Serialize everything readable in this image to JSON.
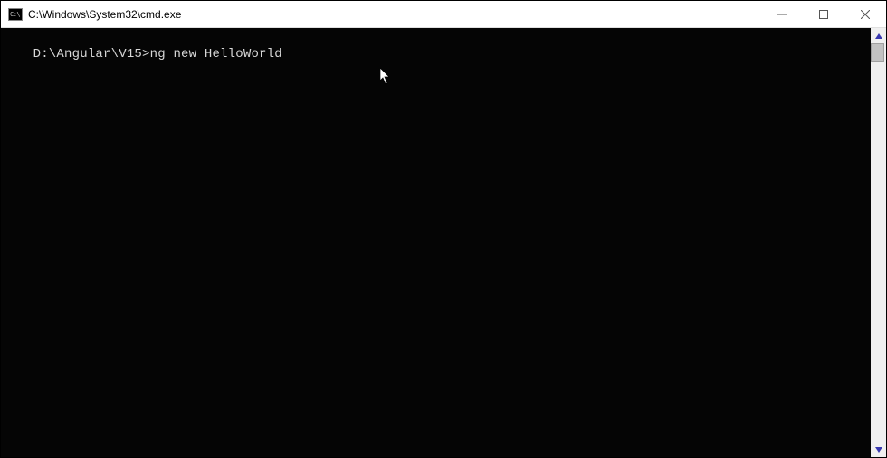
{
  "window": {
    "title": "C:\\Windows\\System32\\cmd.exe",
    "icon_label": "C:\\"
  },
  "terminal": {
    "prompt": "D:\\Angular\\V15>",
    "command": "ng new HelloWorld"
  }
}
